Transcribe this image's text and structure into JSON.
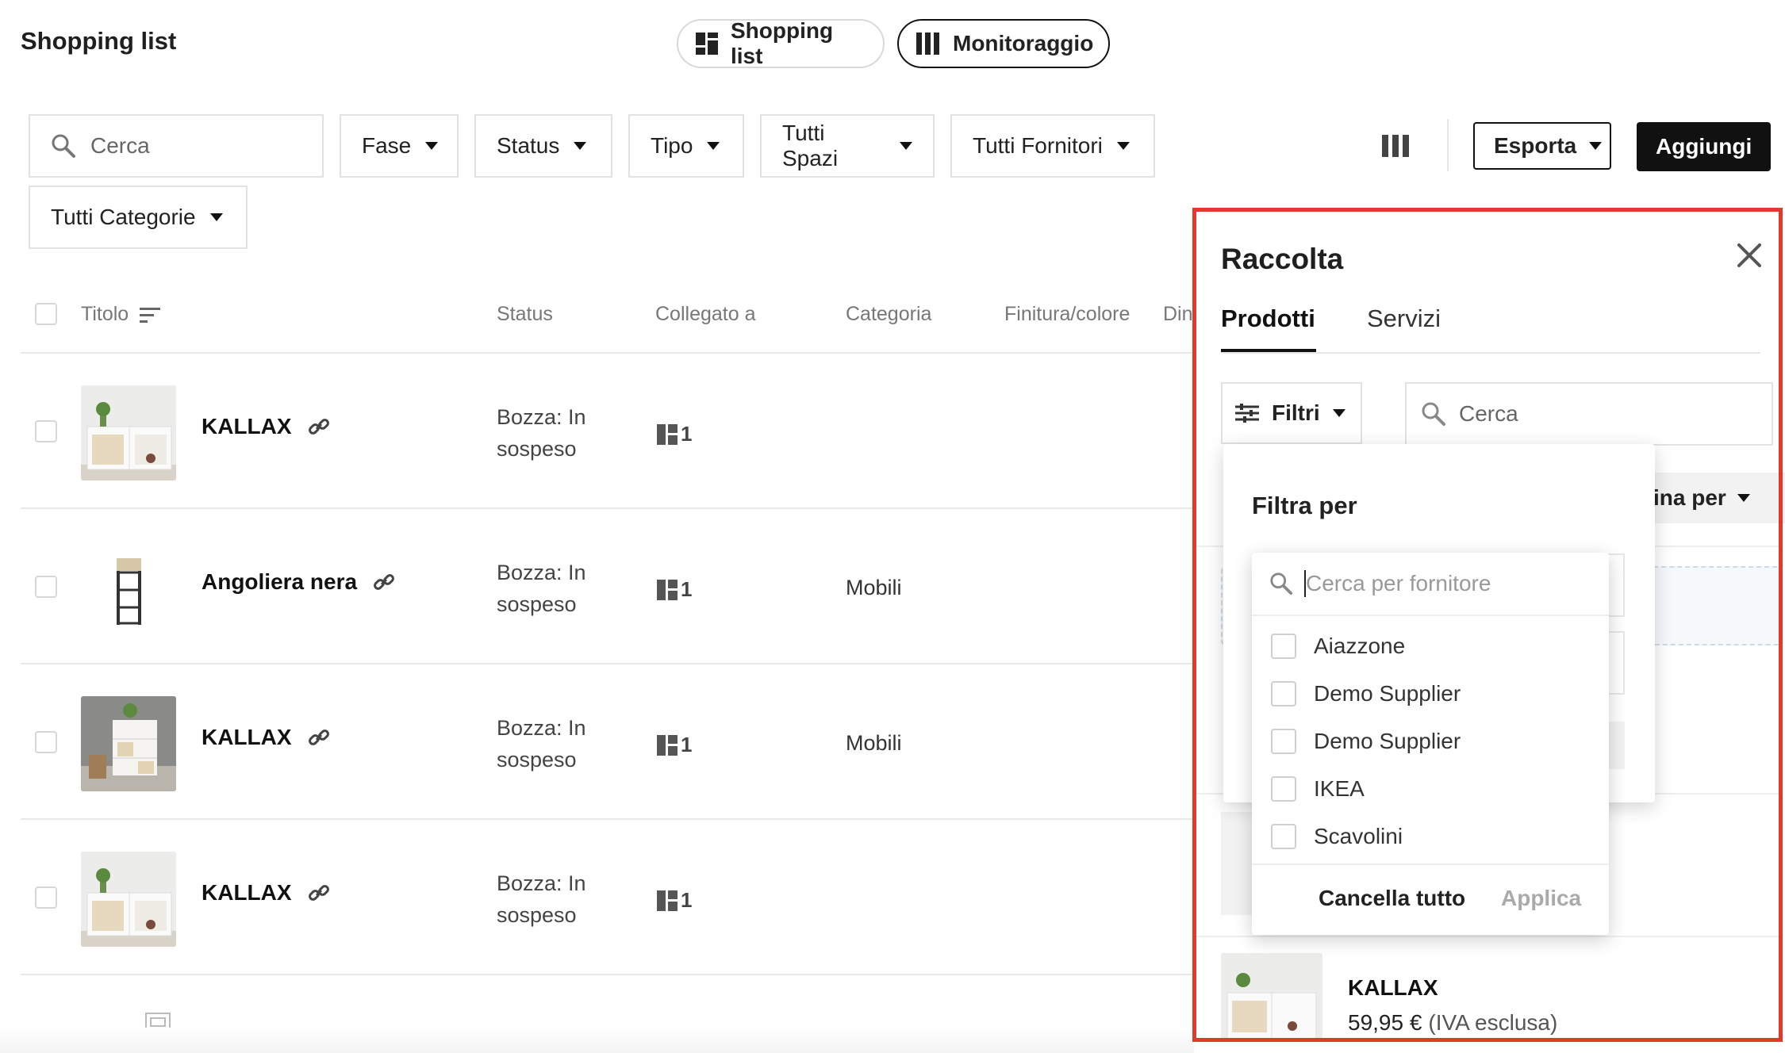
{
  "header": {
    "title": "Shopping list",
    "views": [
      {
        "label": "Shopping list",
        "icon": "dashboard-icon"
      },
      {
        "label": "Monitoraggio",
        "icon": "columns-icon"
      }
    ]
  },
  "filters": {
    "search_placeholder": "Cerca",
    "dropdowns": [
      "Fase",
      "Status",
      "Tipo",
      "Tutti Spazi",
      "Tutti Fornitori",
      "Tutti Categorie"
    ],
    "export_label": "Esporta",
    "add_label": "Aggiungi"
  },
  "table": {
    "columns": [
      "Titolo",
      "Status",
      "Collegato a",
      "Categoria",
      "Finitura/colore",
      "Din"
    ],
    "rows": [
      {
        "title": "KALLAX",
        "status_line1": "Bozza: In",
        "status_line2": "sospeso",
        "linked": "1",
        "category": ""
      },
      {
        "title": "Angoliera nera",
        "status_line1": "Bozza: In",
        "status_line2": "sospeso",
        "linked": "1",
        "category": "Mobili"
      },
      {
        "title": "KALLAX",
        "status_line1": "Bozza: In",
        "status_line2": "sospeso",
        "linked": "1",
        "category": "Mobili"
      },
      {
        "title": "KALLAX",
        "status_line1": "Bozza: In",
        "status_line2": "sospeso",
        "linked": "1",
        "category": ""
      }
    ]
  },
  "panel": {
    "title": "Raccolta",
    "tabs": [
      "Prodotti",
      "Servizi"
    ],
    "filters_label": "Filtri",
    "search_placeholder": "Cerca",
    "sort_partial": "ina per",
    "filter_heading": "Filtra per",
    "supplier_search_placeholder": "Cerca per fornitore",
    "suppliers": [
      "Aiazzone",
      "Demo Supplier",
      "Demo Supplier",
      "IKEA",
      "Scavolini"
    ],
    "clear_all": "Cancella tutto",
    "apply": "Applica",
    "product": {
      "name": "KALLAX",
      "price": "59,95 €",
      "price_note": "(IVA esclusa)"
    }
  },
  "colors": {
    "highlight": "#e03a2b",
    "dark": "#111111",
    "border": "#e2e2e2"
  }
}
